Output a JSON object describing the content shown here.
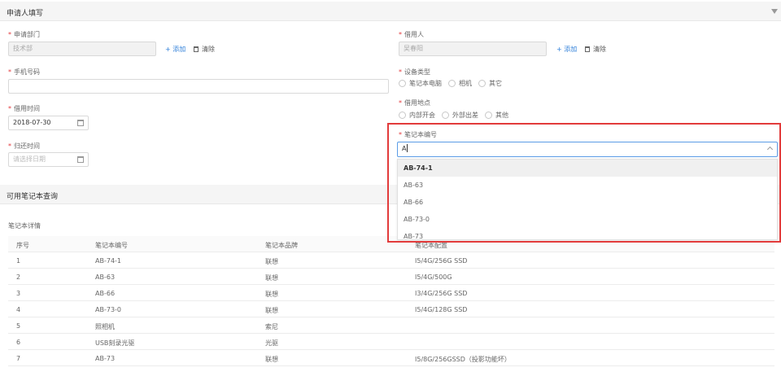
{
  "applicant_section": {
    "title": "申请人填写"
  },
  "dept": {
    "label": "申请部门",
    "value": "技术部",
    "add": "添加",
    "clear": "清除"
  },
  "borrower": {
    "label": "借用人",
    "value": "吴春阳",
    "add": "添加",
    "clear": "清除"
  },
  "phone": {
    "label": "手机号码",
    "value": ""
  },
  "device_type": {
    "label": "设备类型",
    "options": [
      "笔记本电脑",
      "相机",
      "其它"
    ]
  },
  "borrow_time": {
    "label": "借用时间",
    "value": "2018-07-30"
  },
  "location": {
    "label": "借用地点",
    "options": [
      "内部开会",
      "外部出差",
      "其他"
    ]
  },
  "laptop_no": {
    "label": "笔记本编号",
    "value": "A"
  },
  "return_time": {
    "label": "归还时间",
    "placeholder": "请选择日期"
  },
  "dropdown": {
    "items": [
      "AB-74-1",
      "AB-63",
      "AB-66",
      "AB-73-0",
      "AB-73"
    ]
  },
  "query_section": {
    "title": "可用笔记本查询"
  },
  "details": {
    "label": "笔记本详情"
  },
  "table": {
    "headers": [
      "序号",
      "笔记本编号",
      "笔记本品牌",
      "笔记本配置"
    ],
    "rows": [
      [
        "1",
        "AB-74-1",
        "联想",
        "I5/4G/256G SSD"
      ],
      [
        "2",
        "AB-63",
        "联想",
        "I5/4G/500G"
      ],
      [
        "3",
        "AB-66",
        "联想",
        "I3/4G/256G SSD"
      ],
      [
        "4",
        "AB-73-0",
        "联想",
        "I5/4G/128G SSD"
      ],
      [
        "5",
        "照相机",
        "索尼",
        ""
      ],
      [
        "6",
        "USB刻录光驱",
        "光驱",
        ""
      ],
      [
        "7",
        "AB-73",
        "联想",
        "I5/8G/256GSSD（投影功能坏）"
      ]
    ]
  }
}
